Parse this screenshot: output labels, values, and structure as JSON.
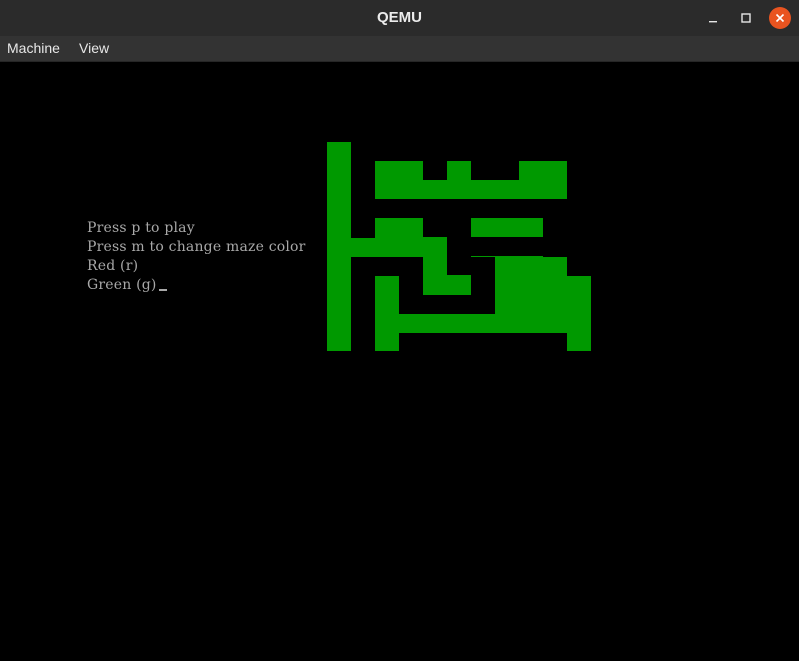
{
  "window": {
    "title": "QEMU",
    "minimize_icon": "minimize-icon",
    "maximize_icon": "maximize-icon",
    "close_icon": "close-icon",
    "close_color": "#e95420"
  },
  "menubar": {
    "items": [
      {
        "label": "Machine"
      },
      {
        "label": "View"
      }
    ]
  },
  "terminal": {
    "lines": [
      "Press p to play",
      "Press m to change maze color",
      "Red (r)",
      "Green (g)"
    ],
    "text_color": "#a8a8a8"
  },
  "maze": {
    "color": "#009900"
  }
}
